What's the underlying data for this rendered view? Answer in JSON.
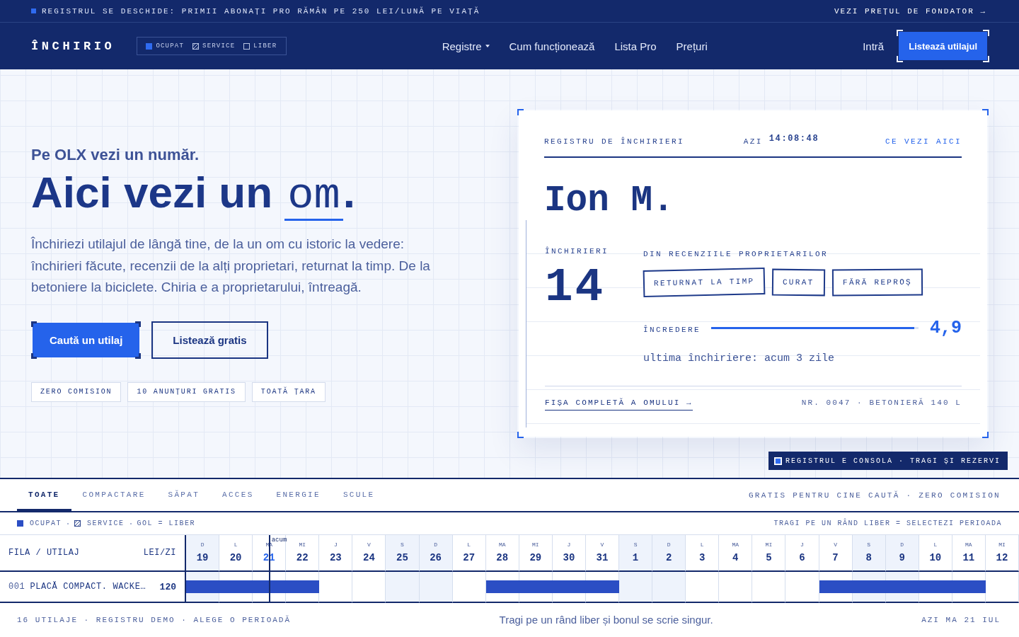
{
  "announcement_bar": {
    "text": "REGISTRUL SE DESCHIDE: PRIMII ABONAȚI PRO RĂMÂN PE 250 LEI/LUNĂ PE VIAȚĂ",
    "link": "VEZI PREȚUL DE FONDATOR →"
  },
  "navbar": {
    "logo": "ÎNCHIRIO",
    "legend": [
      {
        "kind": "occupied",
        "label": "OCUPAT"
      },
      {
        "kind": "service",
        "label": "SERVICE"
      },
      {
        "kind": "free",
        "label": "LIBER"
      }
    ],
    "links": [
      {
        "label": "Registre",
        "dropdown": true
      },
      {
        "label": "Cum funcționează",
        "dropdown": false
      },
      {
        "label": "Lista Pro",
        "dropdown": false
      },
      {
        "label": "Prețuri",
        "dropdown": false
      }
    ],
    "login": "Intră",
    "cta": "Listează utilajul"
  },
  "hero": {
    "kicker": "Pe OLX vezi un număr.",
    "headline": {
      "lead": "Aici vezi un",
      "accent": "om",
      "end": "."
    },
    "paragraph": "Închiriezi utilajul de lângă tine, de la un om cu istoric la vedere: închirieri făcute, recenzii de la alți proprietari, returnat la timp. De la betoniere la biciclete. Chiria e a proprietarului, întreagă.",
    "buttons": [
      {
        "label": "Caută un utilaj",
        "kind": "primary"
      },
      {
        "label": "Listează gratis",
        "kind": "secondary"
      }
    ],
    "tags": [
      "ZERO COMISION",
      "10 ANUNȚURI GRATIS",
      "TOATĂ ȚARA"
    ]
  },
  "record_card": {
    "title": "REGISTRU DE ÎNCHIRIERI",
    "clock_label": "AZI",
    "clock": "14:08:48",
    "help_link": "CE VEZI AICI",
    "name": "Ion M.",
    "rentals_label": "ÎNCHIRIERI",
    "rentals": "14",
    "reviews_label": "DIN RECENZIILE PROPRIETARILOR",
    "stamps": [
      "RETURNAT LA TIMP",
      "CURAT",
      "FĂRĂ REPROȘ"
    ],
    "trust": {
      "label": "ÎNCREDERE",
      "level": 0.98,
      "reading": "4,9"
    },
    "last_rental": "ultima închiriere: acum 3 zile",
    "profile_link": "FIȘA COMPLETĂ A OMULUI →",
    "listing": "NR. 0047 · BETONIERĂ 140 L"
  },
  "console_badge": "REGISTRUL E CONSOLA · TRAGI ȘI REZERVI",
  "category_tabs": [
    {
      "label": "TOATE",
      "selected": true
    },
    {
      "label": "COMPACTARE",
      "selected": false
    },
    {
      "label": "SĂPAT",
      "selected": false
    },
    {
      "label": "ACCES",
      "selected": false
    },
    {
      "label": "ENERGIE",
      "selected": false
    },
    {
      "label": "SCULE",
      "selected": false
    }
  ],
  "tabs_note": "GRATIS PENTRU CINE CAUTĂ · ZERO COMISION",
  "calendar": {
    "legend": [
      {
        "kind": "occupied",
        "label": "OCUPAT"
      },
      {
        "kind": "service",
        "label": "SERVICE"
      },
      {
        "kind": "note",
        "label": "GOL = LIBER"
      }
    ],
    "hint": "TRAGI PE UN RÂND LIBER = SELECTEZI PERIOADA",
    "columns": {
      "item": "FILA / UTILAJ",
      "price": "LEI/ZI"
    },
    "now_label": "acum",
    "days": [
      {
        "weekday": "D",
        "date": "19",
        "weekend": true,
        "today": false
      },
      {
        "weekday": "L",
        "date": "20",
        "weekend": false,
        "today": false
      },
      {
        "weekday": "MA",
        "date": "21",
        "weekend": false,
        "today": true
      },
      {
        "weekday": "MI",
        "date": "22",
        "weekend": false,
        "today": false
      },
      {
        "weekday": "J",
        "date": "23",
        "weekend": false,
        "today": false
      },
      {
        "weekday": "V",
        "date": "24",
        "weekend": false,
        "today": false
      },
      {
        "weekday": "S",
        "date": "25",
        "weekend": true,
        "today": false
      },
      {
        "weekday": "D",
        "date": "26",
        "weekend": true,
        "today": false
      },
      {
        "weekday": "L",
        "date": "27",
        "weekend": false,
        "today": false
      },
      {
        "weekday": "MA",
        "date": "28",
        "weekend": false,
        "today": false
      },
      {
        "weekday": "MI",
        "date": "29",
        "weekend": false,
        "today": false
      },
      {
        "weekday": "J",
        "date": "30",
        "weekend": false,
        "today": false
      },
      {
        "weekday": "V",
        "date": "31",
        "weekend": false,
        "today": false
      },
      {
        "weekday": "S",
        "date": "1",
        "weekend": true,
        "today": false
      },
      {
        "weekday": "D",
        "date": "2",
        "weekend": true,
        "today": false
      },
      {
        "weekday": "L",
        "date": "3",
        "weekend": false,
        "today": false
      },
      {
        "weekday": "MA",
        "date": "4",
        "weekend": false,
        "today": false
      },
      {
        "weekday": "MI",
        "date": "5",
        "weekend": false,
        "today": false
      },
      {
        "weekday": "J",
        "date": "6",
        "weekend": false,
        "today": false
      },
      {
        "weekday": "V",
        "date": "7",
        "weekend": false,
        "today": false
      },
      {
        "weekday": "S",
        "date": "8",
        "weekend": true,
        "today": false
      },
      {
        "weekday": "D",
        "date": "9",
        "weekend": true,
        "today": false
      },
      {
        "weekday": "L",
        "date": "10",
        "weekend": false,
        "today": false
      },
      {
        "weekday": "MA",
        "date": "11",
        "weekend": false,
        "today": false
      },
      {
        "weekday": "MI",
        "date": "12",
        "weekend": false,
        "today": false
      }
    ],
    "rows": [
      {
        "number": "001",
        "name": "PLACĂ COMPACT. WACKE…",
        "price": "120",
        "cells": [
          {
            "occupied": true
          },
          {
            "occupied": true
          },
          {
            "occupied": true
          },
          {
            "occupied": true
          },
          {
            "occupied": false
          },
          {
            "occupied": false
          },
          {
            "occupied": false
          },
          {
            "occupied": false
          },
          {
            "occupied": false
          },
          {
            "occupied": true
          },
          {
            "occupied": true
          },
          {
            "occupied": true
          },
          {
            "occupied": true
          },
          {
            "occupied": false
          },
          {
            "occupied": false
          },
          {
            "occupied": false
          },
          {
            "occupied": false
          },
          {
            "occupied": false
          },
          {
            "occupied": false
          },
          {
            "occupied": true
          },
          {
            "occupied": true
          },
          {
            "occupied": true
          },
          {
            "occupied": true
          },
          {
            "occupied": true
          },
          {
            "occupied": false
          }
        ]
      }
    ]
  },
  "footer": {
    "left": "16 UTILAJE · REGISTRU DEMO · ALEGE O PERIOADĂ",
    "center": "Tragi pe un rând liber și bonul se scrie singur.",
    "right": "AZI MA 21 IUL"
  }
}
